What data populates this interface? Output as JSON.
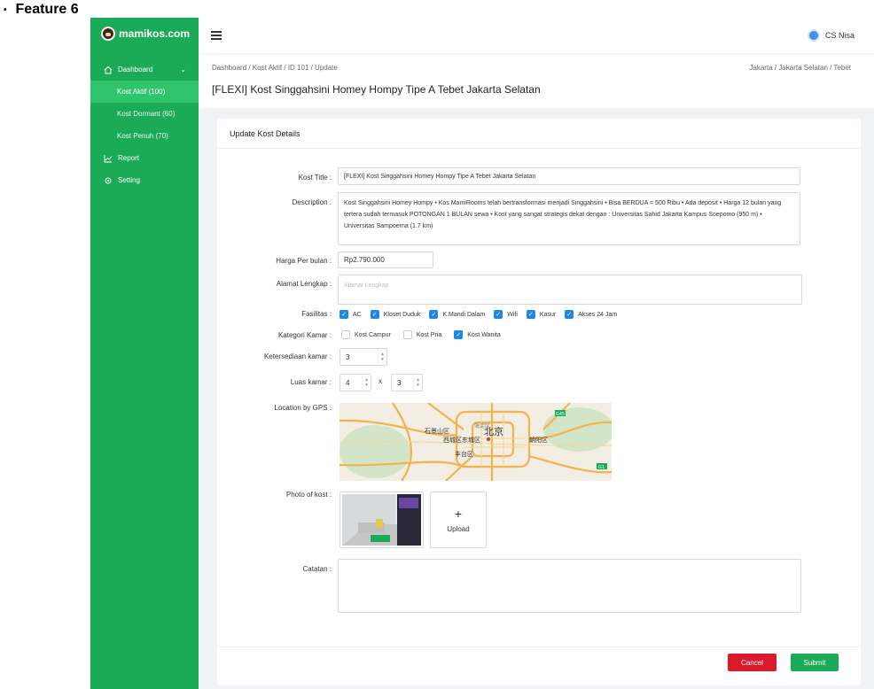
{
  "feature_title": "Feature 6",
  "brand": {
    "name": "mamikos.com"
  },
  "sidebar": {
    "items": [
      {
        "label": "Dashboard",
        "icon": "home-icon"
      },
      {
        "label": "Kost Aktif (100)",
        "active": true
      },
      {
        "label": "Kost Dormant (60)"
      },
      {
        "label": "Kost Penuh (70)"
      },
      {
        "label": "Report",
        "icon": "chart-icon"
      },
      {
        "label": "Setting",
        "icon": "gear-icon"
      }
    ]
  },
  "topbar": {
    "user_name": "CS Nisa"
  },
  "breadcrumb": {
    "left": "Dashboard  /  Kost Aktif  /  ID 101  /  Update",
    "right": "Jakarta  /  Jakarta Selatan  /  Tebet"
  },
  "page_title": "[FLEXI] Kost Singgahsini Homey Hompy Tipe A Tebet Jakarta Selatan",
  "card": {
    "title": "Update Kost Details",
    "fields": {
      "kost_title": {
        "label": "Kost Title :",
        "value": "[FLEXI] Kost Singgahsini Homey Hompy Tipe A Tebet Jakarta Selatan"
      },
      "description": {
        "label": "Description :",
        "value": "Kost Singgahsini Homey Hompy • Kos MamiRooms telah bertransformasi menjadi Singgahsini • Bisa BERDUA = 500 Ribu • Ada deposit • Harga 12 bulan yang tertera sudah termasuk POTONGAN 1 BULAN sewa • Kost yang sangat strategis dekat dengan : Universitas Sahid Jakarta Kampus Soepomo (950 m) • Universitas Sampoerna (1.7 km)"
      },
      "harga": {
        "label": "Harga Per bulan :",
        "value": "Rp2.790.000"
      },
      "alamat": {
        "label": "Alamat Lengkap :",
        "placeholder": "Alamat Lengkap"
      },
      "fasilitas": {
        "label": "Fasilitas :",
        "options": [
          {
            "label": "AC",
            "checked": true
          },
          {
            "label": "Kloset Duduk",
            "checked": true
          },
          {
            "label": "K.Mandi Dalam",
            "checked": true
          },
          {
            "label": "Wifi",
            "checked": true
          },
          {
            "label": "Kasur",
            "checked": true
          },
          {
            "label": "Akses 24 Jam",
            "checked": true
          }
        ]
      },
      "kategori": {
        "label": "Kategori Kamar :",
        "options": [
          {
            "label": "Kost Campur",
            "checked": false
          },
          {
            "label": "Kost Pria",
            "checked": false
          },
          {
            "label": "Kost Wanita",
            "checked": true
          }
        ]
      },
      "ketersediaan": {
        "label": "Ketersediaan kamar :",
        "value": "3"
      },
      "luas": {
        "label": "Luas kamar :",
        "width": "4",
        "separator": "x",
        "length": "3"
      },
      "location": {
        "label": "Location by GPS :",
        "map_labels": [
          "北京",
          "海淀区",
          "西城区",
          "东城区",
          "朝阳区",
          "丰台区",
          "石景山区",
          "G1",
          "G45",
          "G4"
        ]
      },
      "photo": {
        "label": "Photo of kost :",
        "upload_label": "Upload",
        "upload_icon": "plus-icon"
      },
      "catatan": {
        "label": "Catatan :"
      }
    }
  },
  "actions": {
    "cancel": "Cancel",
    "submit": "Submit"
  },
  "colors": {
    "brand_green": "#1baa56",
    "sidebar_active": "#2fc36c",
    "cancel_red": "#d9192c",
    "checkbox_blue": "#1e88e5"
  }
}
